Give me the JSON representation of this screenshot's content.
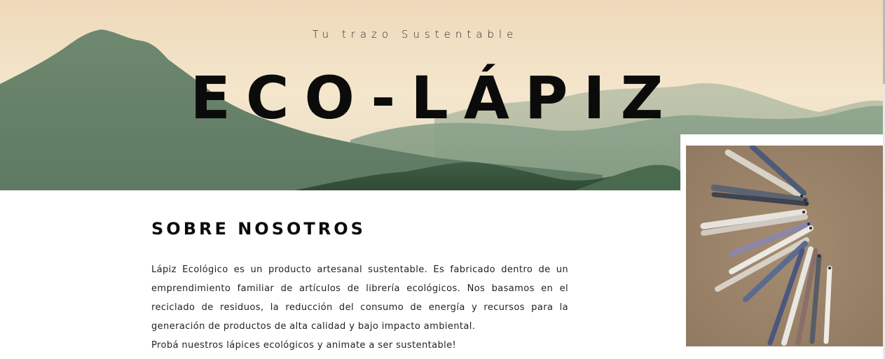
{
  "hero": {
    "tagline": "Tu trazo Sustentable",
    "title": "ECO-LÁPIZ"
  },
  "about": {
    "heading": "SOBRE NOSOTROS",
    "paragraph_1": "Lápiz Ecológico es un producto artesanal sustentable. Es fabricado dentro de un emprendimiento familiar de artículos de librería ecológicos. Nos basamos en el reciclado de residuos, la reducción del consumo de energía y recursos para la generación de productos de alta calidad y bajo impacto ambiental.",
    "paragraph_2": "Probá nuestros lápices ecológicos y animate a ser sustentable!"
  },
  "colors": {
    "sky": "#efdcbe",
    "mountain": "#6f8a72",
    "text": "#0b0b0b",
    "photo_background": "#9b8468"
  },
  "icons": {
    "hero_image": "mountain-landscape-image",
    "product_image": "recycled-pencils-photo"
  }
}
